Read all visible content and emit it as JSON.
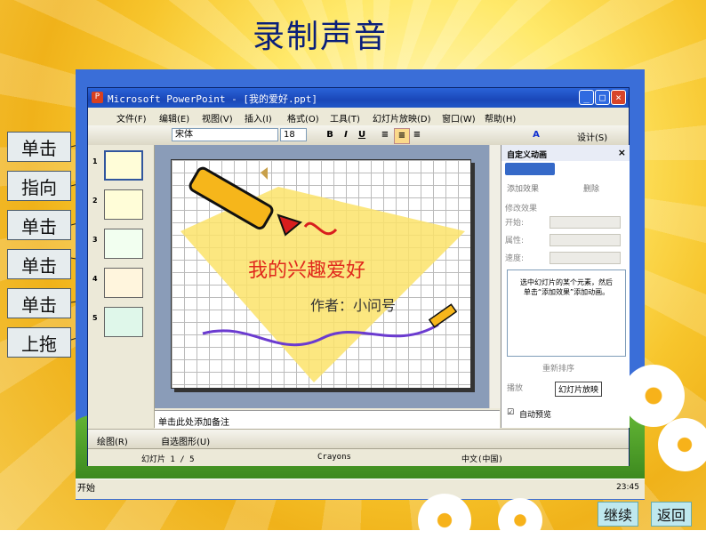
{
  "page": {
    "title": "录制声音",
    "side_buttons": [
      "单击",
      "指向",
      "单击",
      "单击",
      "单击",
      "上拖"
    ],
    "nav": {
      "continue": "继续",
      "back": "返回"
    }
  },
  "window": {
    "title": "Microsoft PowerPoint - [我的爱好.ppt]",
    "menu": [
      "文件(F)",
      "编辑(E)",
      "视图(V)",
      "插入(I)",
      "格式(O)",
      "工具(T)",
      "幻灯片放映(D)",
      "窗口(W)",
      "帮助(H)"
    ],
    "toolbar": {
      "font": "宋体",
      "size": "18",
      "bold": "B",
      "italic": "I",
      "underline": "U",
      "design": "设计(S)"
    },
    "slide_numbers": [
      "1",
      "2",
      "3",
      "4",
      "5"
    ],
    "slide": {
      "heading": "我的兴趣爱好",
      "author": "作者：小问号"
    },
    "notes_placeholder": "单击此处添加备注",
    "draw_toolbar": {
      "draw": "绘图(R)",
      "autoshapes": "自选图形(U)"
    },
    "status": {
      "slide": "幻灯片 1 / 5",
      "design": "Crayons",
      "lang": "中文(中国)"
    }
  },
  "task_pane": {
    "title": "自定义动画",
    "add_effect": "添加效果",
    "remove": "删除",
    "modify_effect": "修改效果",
    "start_label": "开始:",
    "property_label": "属性:",
    "speed_label": "速度:",
    "hint": "选中幻灯片的某个元素，然后单击“添加效果”添加动画。",
    "reorder": "重新排序",
    "play": "播放",
    "slideshow": "幻灯片放映",
    "autopreview": "自动预览"
  },
  "taskbar": {
    "start": "开始",
    "clock": "23:45"
  }
}
